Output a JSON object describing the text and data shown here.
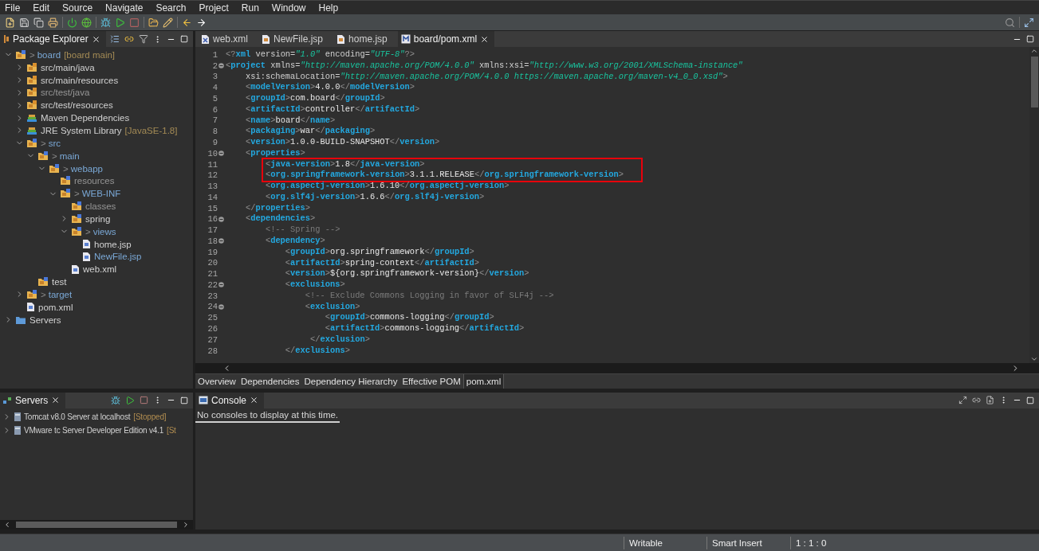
{
  "menu": [
    "File",
    "Edit",
    "Source",
    "Navigate",
    "Search",
    "Project",
    "Run",
    "Window",
    "Help"
  ],
  "package_explorer": {
    "title": "Package Explorer",
    "tree": [
      {
        "label": "board",
        "prefix": ">",
        "decoration": "[board main]",
        "kind": "project",
        "changed": true,
        "dimmed": false,
        "expanded": true,
        "children": [
          {
            "label": "src/main/java",
            "kind": "source-folder",
            "changed": false,
            "dimmed": false,
            "expanded": false
          },
          {
            "label": "src/main/resources",
            "kind": "source-folder",
            "changed": false,
            "dimmed": false,
            "expanded": false
          },
          {
            "label": "src/test/java",
            "kind": "source-folder",
            "changed": false,
            "dimmed": true,
            "expanded": false
          },
          {
            "label": "src/test/resources",
            "kind": "source-folder",
            "changed": false,
            "dimmed": false,
            "expanded": false
          },
          {
            "label": "Maven Dependencies",
            "kind": "library",
            "changed": false,
            "dimmed": false,
            "expanded": false
          },
          {
            "label": "JRE System Library",
            "decoration": "[JavaSE-1.8]",
            "kind": "library",
            "changed": false,
            "dimmed": false,
            "expanded": false
          },
          {
            "label": "src",
            "prefix": ">",
            "kind": "folder",
            "changed": true,
            "dimmed": false,
            "expanded": true,
            "children": [
              {
                "label": "main",
                "prefix": ">",
                "kind": "folder",
                "changed": true,
                "dimmed": false,
                "expanded": true,
                "children": [
                  {
                    "label": "webapp",
                    "prefix": ">",
                    "kind": "folder",
                    "changed": true,
                    "dimmed": false,
                    "expanded": true,
                    "children": [
                      {
                        "label": "resources",
                        "kind": "folder",
                        "changed": false,
                        "dimmed": true
                      },
                      {
                        "label": "WEB-INF",
                        "prefix": ">",
                        "kind": "folder",
                        "changed": true,
                        "dimmed": false,
                        "expanded": true,
                        "children": [
                          {
                            "label": "classes",
                            "kind": "folder",
                            "changed": false,
                            "dimmed": true
                          },
                          {
                            "label": "spring",
                            "kind": "folder",
                            "changed": false,
                            "dimmed": false,
                            "expanded": false
                          },
                          {
                            "label": "views",
                            "prefix": ">",
                            "kind": "folder",
                            "changed": true,
                            "dimmed": false,
                            "expanded": true,
                            "children": [
                              {
                                "label": "home.jsp",
                                "kind": "file",
                                "changed": false,
                                "dimmed": false
                              },
                              {
                                "label": "NewFile.jsp",
                                "kind": "file",
                                "changed": true,
                                "dimmed": false
                              }
                            ]
                          },
                          {
                            "label": "web.xml",
                            "kind": "file",
                            "changed": false,
                            "dimmed": false
                          }
                        ]
                      }
                    ]
                  }
                ]
              },
              {
                "label": "test",
                "kind": "folder",
                "changed": false,
                "dimmed": false
              }
            ]
          },
          {
            "label": "target",
            "prefix": ">",
            "kind": "folder",
            "changed": true,
            "dimmed": false,
            "expanded": false
          },
          {
            "label": "pom.xml",
            "kind": "file",
            "changed": false,
            "dimmed": false
          }
        ]
      },
      {
        "label": "Servers",
        "kind": "plain-folder",
        "changed": false,
        "dimmed": false,
        "expanded": false
      }
    ]
  },
  "editor": {
    "tabs": [
      {
        "label": "web.xml",
        "kind": "xml",
        "selected": false
      },
      {
        "label": "NewFile.jsp",
        "kind": "jsp",
        "selected": false
      },
      {
        "label": "home.jsp",
        "kind": "jsp",
        "selected": false
      },
      {
        "label": "board/pom.xml",
        "kind": "maven",
        "selected": true
      }
    ],
    "lines": [
      {
        "n": "1",
        "text": "<?xml version=\"1.0\" encoding=\"UTF-8\"?>",
        "fold": false,
        "highlighted": false
      },
      {
        "n": "2",
        "text": "<project xmlns=\"http://maven.apache.org/POM/4.0.0\" xmlns:xsi=\"http://www.w3.org/2001/XMLSchema-instance\"",
        "fold": true,
        "highlighted": false
      },
      {
        "n": "3",
        "text": "    xsi:schemaLocation=\"http://maven.apache.org/POM/4.0.0 https://maven.apache.org/maven-v4_0_0.xsd\">",
        "fold": false,
        "highlighted": false
      },
      {
        "n": "4",
        "text": "    <modelVersion>4.0.0</modelVersion>",
        "fold": false,
        "highlighted": false
      },
      {
        "n": "5",
        "text": "    <groupId>com.board</groupId>",
        "fold": false,
        "highlighted": false
      },
      {
        "n": "6",
        "text": "    <artifactId>controller</artifactId>",
        "fold": false,
        "highlighted": false
      },
      {
        "n": "7",
        "text": "    <name>board</name>",
        "fold": false,
        "highlighted": false
      },
      {
        "n": "8",
        "text": "    <packaging>war</packaging>",
        "fold": false,
        "highlighted": false
      },
      {
        "n": "9",
        "text": "    <version>1.0.0-BUILD-SNAPSHOT</version>",
        "fold": false,
        "highlighted": false
      },
      {
        "n": "10",
        "text": "    <properties>",
        "fold": true,
        "highlighted": false
      },
      {
        "n": "11",
        "text": "        <java-version>1.8</java-version>",
        "fold": false,
        "highlighted": true
      },
      {
        "n": "12",
        "text": "        <org.springframework-version>3.1.1.RELEASE</org.springframework-version>",
        "fold": false,
        "highlighted": true
      },
      {
        "n": "13",
        "text": "        <org.aspectj-version>1.6.10</org.aspectj-version>",
        "fold": false,
        "highlighted": false
      },
      {
        "n": "14",
        "text": "        <org.slf4j-version>1.6.6</org.slf4j-version>",
        "fold": false,
        "highlighted": false
      },
      {
        "n": "15",
        "text": "    </properties>",
        "fold": false,
        "highlighted": false
      },
      {
        "n": "16",
        "text": "    <dependencies>",
        "fold": true,
        "highlighted": false
      },
      {
        "n": "17",
        "text": "        <!-- Spring -->",
        "fold": false,
        "highlighted": false
      },
      {
        "n": "18",
        "text": "        <dependency>",
        "fold": true,
        "highlighted": false
      },
      {
        "n": "19",
        "text": "            <groupId>org.springframework</groupId>",
        "fold": false,
        "highlighted": false
      },
      {
        "n": "20",
        "text": "            <artifactId>spring-context</artifactId>",
        "fold": false,
        "highlighted": false
      },
      {
        "n": "21",
        "text": "            <version>${org.springframework-version}</version>",
        "fold": false,
        "highlighted": false
      },
      {
        "n": "22",
        "text": "            <exclusions>",
        "fold": true,
        "highlighted": false
      },
      {
        "n": "23",
        "text": "                <!-- Exclude Commons Logging in favor of SLF4j -->",
        "fold": false,
        "highlighted": false
      },
      {
        "n": "24",
        "text": "                <exclusion>",
        "fold": true,
        "highlighted": false
      },
      {
        "n": "25",
        "text": "                    <groupId>commons-logging</groupId>",
        "fold": false,
        "highlighted": false
      },
      {
        "n": "26",
        "text": "                    <artifactId>commons-logging</artifactId>",
        "fold": false,
        "highlighted": false
      },
      {
        "n": "27",
        "text": "                 </exclusion>",
        "fold": false,
        "highlighted": false
      },
      {
        "n": "28",
        "text": "            </exclusions>",
        "fold": false,
        "highlighted": false
      }
    ],
    "page_tabs": [
      {
        "label": "Overview",
        "selected": false
      },
      {
        "label": "Dependencies",
        "selected": false
      },
      {
        "label": "Dependency Hierarchy",
        "selected": false
      },
      {
        "label": "Effective POM",
        "selected": false
      },
      {
        "label": "pom.xml",
        "selected": true
      }
    ]
  },
  "servers": {
    "title": "Servers",
    "items": [
      {
        "label": "Tomcat v8.0 Server at localhost",
        "status": "[Stopped]",
        "expanded": false
      },
      {
        "label": "VMware tc Server Developer Edition v4.1",
        "status": "[St",
        "expanded": false
      }
    ]
  },
  "console": {
    "title": "Console",
    "message": "No consoles to display at this time."
  },
  "status_bar": [
    "Writable",
    "Smart Insert",
    "1 : 1 : 0"
  ]
}
